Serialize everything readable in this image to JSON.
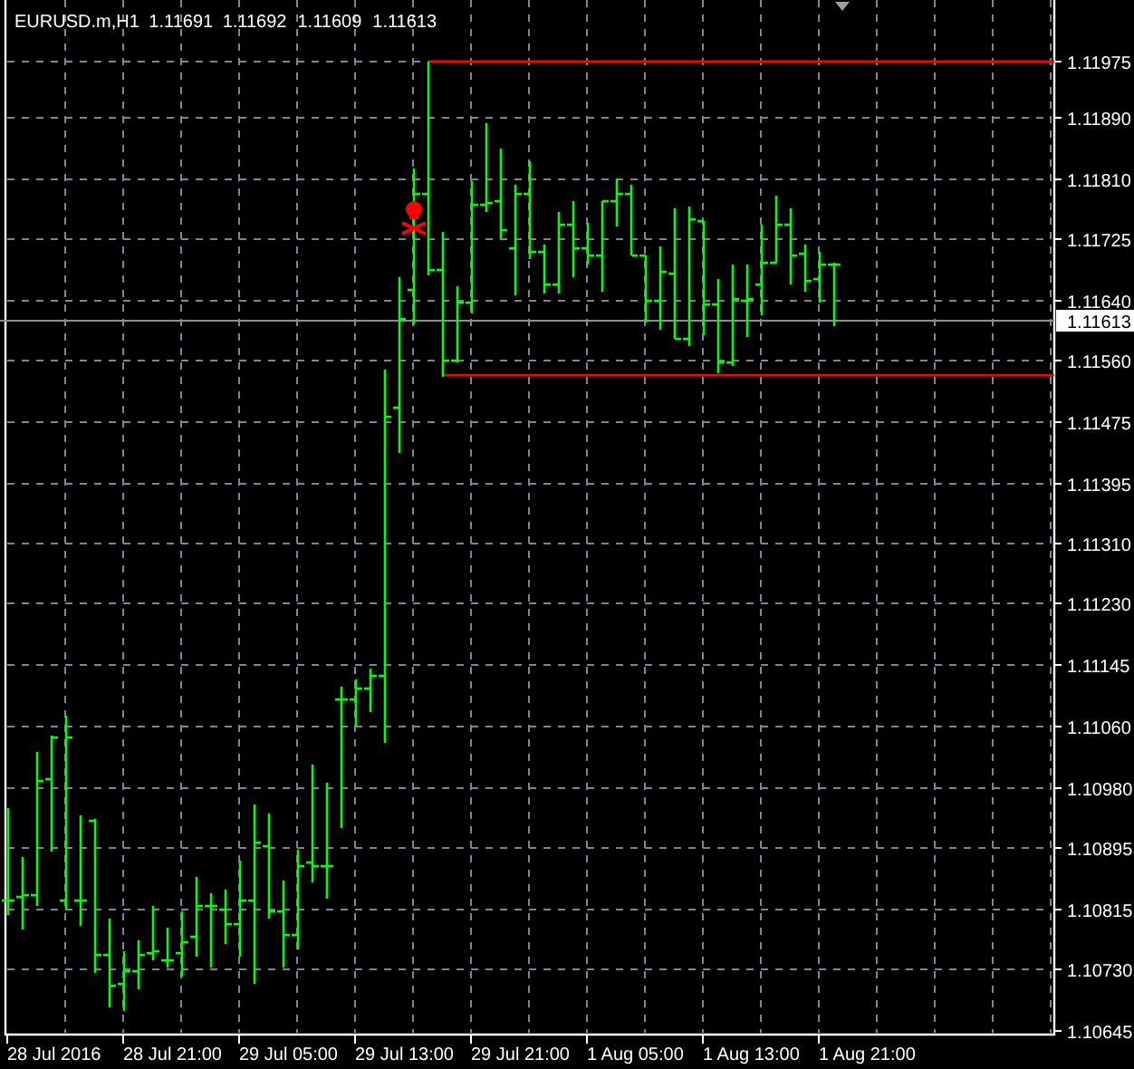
{
  "header": {
    "symbol": "EURUSD.m,H1",
    "quotes": [
      "1.11691",
      "1.11692",
      "1.11609",
      "1.11613"
    ]
  },
  "price_axis": [
    "1.11975",
    "1.11890",
    "1.11810",
    "1.11725",
    "1.11640",
    "1.11560",
    "1.11475",
    "1.11395",
    "1.11310",
    "1.11230",
    "1.11145",
    "1.11060",
    "1.10980",
    "1.10895",
    "1.10815",
    "1.10730",
    "1.10645"
  ],
  "current_price": "1.11613",
  "time_axis": [
    "28 Jul 2016",
    "28 Jul 21:00",
    "29 Jul 05:00",
    "29 Jul 13:00",
    "29 Jul 21:00",
    "1 Aug 05:00",
    "1 Aug 13:00",
    "1 Aug 21:00"
  ]
}
